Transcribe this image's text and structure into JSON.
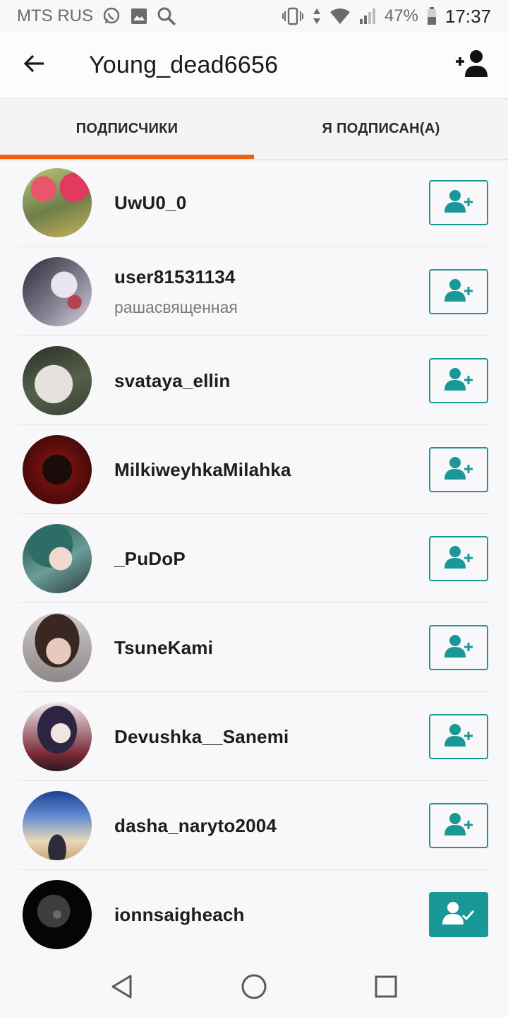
{
  "status": {
    "carrier": "MTS RUS",
    "battery": "47%",
    "time": "17:37",
    "icons": [
      "whatsapp-icon",
      "gallery-icon",
      "search-icon",
      "vibrate-icon",
      "data-arrows-icon",
      "wifi-icon",
      "signal-icon",
      "battery-icon"
    ]
  },
  "header": {
    "title": "Young_dead6656",
    "icons": [
      "back-arrow-icon",
      "add-friend-icon"
    ]
  },
  "tabs": [
    {
      "label": "ПОДПИСЧИКИ",
      "active": true
    },
    {
      "label": "Я ПОДПИСАН(А)",
      "active": false
    }
  ],
  "colors": {
    "accent_orange": "#f0600f",
    "accent_teal": "#1a9797"
  },
  "followers": [
    {
      "username": "UwU0_0",
      "subtitle": "",
      "following": false
    },
    {
      "username": "user81531134",
      "subtitle": "рашасвященная",
      "following": false
    },
    {
      "username": "svataya_ellin",
      "subtitle": "",
      "following": false
    },
    {
      "username": "MilkiweyhkaMilahka",
      "subtitle": "",
      "following": false
    },
    {
      "username": "_PuDoP",
      "subtitle": "",
      "following": false
    },
    {
      "username": "TsuneKami",
      "subtitle": "",
      "following": false
    },
    {
      "username": "Devushka__Sanemi",
      "subtitle": "",
      "following": false
    },
    {
      "username": "dasha_naryto2004",
      "subtitle": "",
      "following": false
    },
    {
      "username": "ionnsaigheach",
      "subtitle": "",
      "following": true
    }
  ],
  "nav": [
    "back-triangle-icon",
    "home-circle-icon",
    "recents-square-icon"
  ]
}
